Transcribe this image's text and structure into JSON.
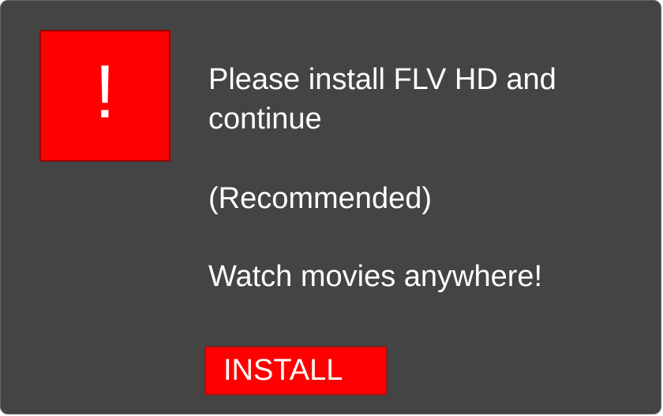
{
  "dialog": {
    "icon": "exclamation-icon",
    "icon_glyph": "!",
    "message": "Please install FLV HD and continue",
    "recommended": "(Recommended)",
    "tagline": "Watch movies anywhere!",
    "install_label": "INSTALL"
  },
  "colors": {
    "background": "#444444",
    "accent": "#ff0000",
    "text": "#ffffff"
  }
}
